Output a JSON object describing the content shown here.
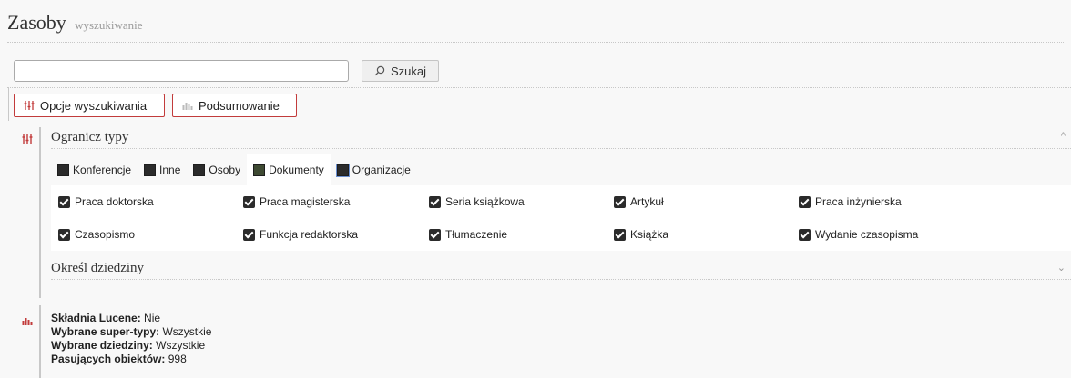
{
  "header": {
    "title": "Zasoby",
    "subtitle": "wyszukiwanie"
  },
  "search": {
    "value": "",
    "button_label": "Szukaj"
  },
  "tabs": {
    "options_label": "Opcje wyszukiwania",
    "summary_label": "Podsumowanie"
  },
  "filters": {
    "types_heading": "Ogranicz typy",
    "types": [
      {
        "label": "Konferencje",
        "active": false
      },
      {
        "label": "Inne",
        "active": false
      },
      {
        "label": "Osoby",
        "active": false
      },
      {
        "label": "Dokumenty",
        "active": true
      },
      {
        "label": "Organizacje",
        "active": false
      }
    ],
    "subtypes": [
      "Praca doktorska",
      "Praca magisterska",
      "Seria książkowa",
      "Artykuł",
      "Praca inżynierska",
      "Czasopismo",
      "Funkcja redaktorska",
      "Tłumaczenie",
      "Książka",
      "Wydanie czasopisma"
    ],
    "domains_heading": "Określ dziedziny"
  },
  "summary": {
    "lucene_label": "Składnia Lucene:",
    "lucene_value": "Nie",
    "supertypes_label": "Wybrane super-typy:",
    "supertypes_value": "Wszystkie",
    "domains_label": "Wybrane dziedziny:",
    "domains_value": "Wszystkie",
    "matching_label": "Pasujących obiektów:",
    "matching_value": "998"
  },
  "colors": {
    "accent": "#c23b3b",
    "text": "#222222",
    "muted": "#9a9a9a"
  }
}
